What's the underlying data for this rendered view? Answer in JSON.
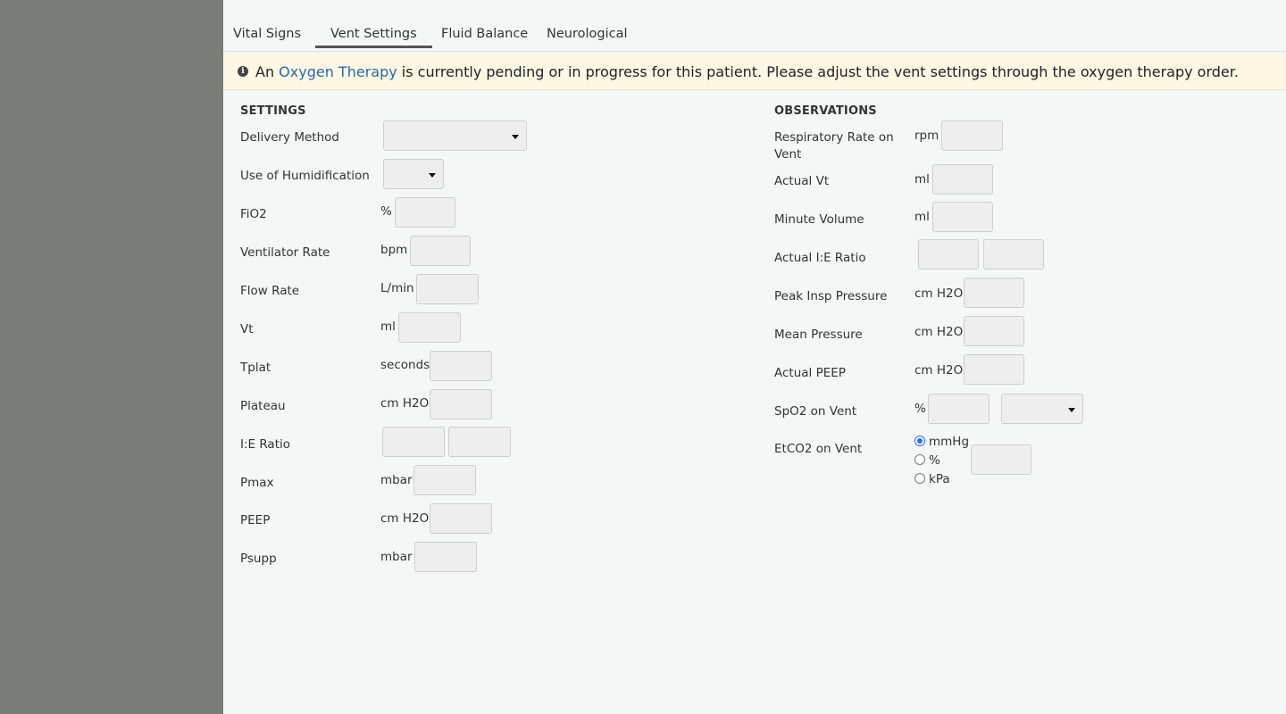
{
  "tabs": [
    {
      "label": "Vital Signs"
    },
    {
      "label": "Vent Settings"
    },
    {
      "label": "Fluid Balance"
    },
    {
      "label": "Neurological"
    }
  ],
  "active_tab": "Vent Settings",
  "banner": {
    "icon": "info-icon",
    "prefix": "An ",
    "link": "Oxygen Therapy",
    "suffix": " is currently pending or in progress for this patient. Please adjust the vent settings through the oxygen therapy order."
  },
  "settings": {
    "title": "SETTINGS",
    "fields": [
      {
        "label": "Delivery Method",
        "unit": "",
        "control": "select",
        "value": ""
      },
      {
        "label": "Use of Humidification",
        "unit": "",
        "control": "select",
        "value": ""
      },
      {
        "label": "FiO2",
        "unit": "%",
        "control": "input",
        "value": ""
      },
      {
        "label": "Ventilator Rate",
        "unit": "bpm",
        "control": "input",
        "value": ""
      },
      {
        "label": "Flow Rate",
        "unit": "L/min",
        "control": "input",
        "value": ""
      },
      {
        "label": "Vt",
        "unit": "ml",
        "control": "input",
        "value": ""
      },
      {
        "label": "Tplat",
        "unit": "seconds",
        "control": "input",
        "value": ""
      },
      {
        "label": "Plateau",
        "unit": "cm H2O",
        "control": "input",
        "value": ""
      },
      {
        "label": "I:E Ratio",
        "unit": "",
        "control": "ratio",
        "value": ""
      },
      {
        "label": "Pmax",
        "unit": "mbar",
        "control": "input",
        "value": ""
      },
      {
        "label": "PEEP",
        "unit": "cm H2O",
        "control": "input",
        "value": ""
      },
      {
        "label": "Psupp",
        "unit": "mbar",
        "control": "input",
        "value": ""
      }
    ]
  },
  "observations": {
    "title": "OBSERVATIONS",
    "fields": [
      {
        "label": "Respiratory Rate on Vent",
        "unit": "rpm",
        "control": "input",
        "value": ""
      },
      {
        "label": "Actual Vt",
        "unit": "ml",
        "control": "input",
        "value": ""
      },
      {
        "label": "Minute Volume",
        "unit": "ml",
        "control": "input",
        "value": ""
      },
      {
        "label": "Actual I:E Ratio",
        "unit": "",
        "control": "ratio",
        "value": ""
      },
      {
        "label": "Peak Insp Pressure",
        "unit": "cm H2O",
        "control": "input",
        "value": ""
      },
      {
        "label": "Mean Pressure",
        "unit": "cm H2O",
        "control": "input",
        "value": ""
      },
      {
        "label": "Actual PEEP",
        "unit": "cm H2O",
        "control": "input",
        "value": ""
      },
      {
        "label": "SpO2 on Vent",
        "unit": "%",
        "control": "input+select",
        "value": ""
      },
      {
        "label": "EtCO2 on Vent",
        "unit": "",
        "control": "radio+input",
        "value": ""
      }
    ],
    "etco2_units": [
      {
        "label": "mmHg",
        "checked": true
      },
      {
        "label": "%",
        "checked": false
      },
      {
        "label": "kPa",
        "checked": false
      }
    ]
  },
  "colors": {
    "sidebar": "#7a7c7a",
    "banner_bg": "#fdf7e4",
    "link": "#2a6aa6",
    "radio_selected": "#2a6ef0"
  }
}
